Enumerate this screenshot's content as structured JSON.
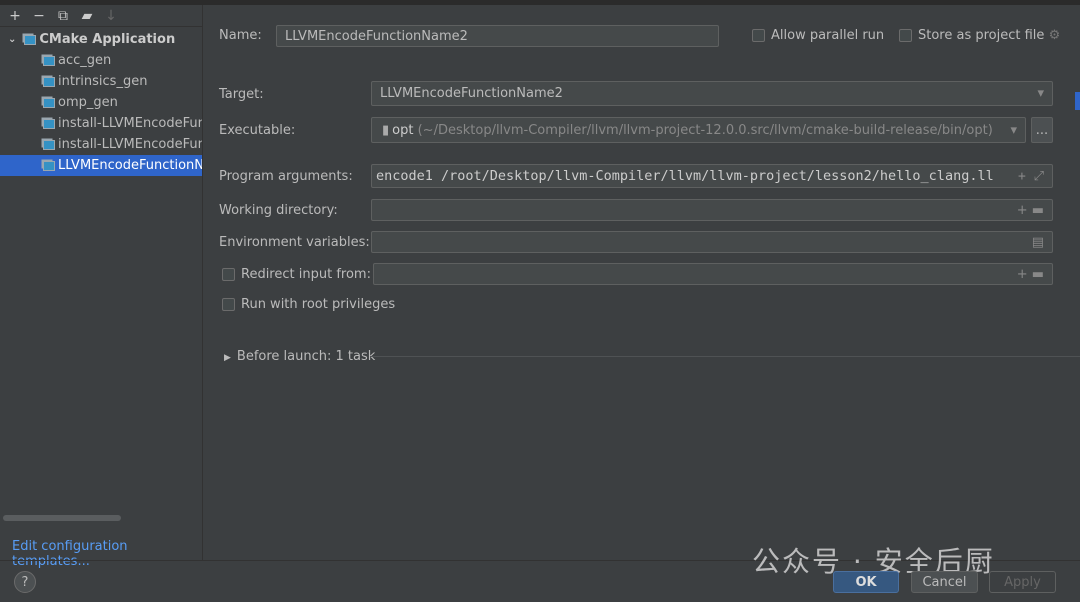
{
  "sidebar": {
    "toolbar": [
      "+",
      "−",
      "⧉",
      "▰",
      "↓"
    ],
    "group": "CMake Application",
    "items": [
      "acc_gen",
      "intrinsics_gen",
      "omp_gen",
      "install-LLVMEncodeFun",
      "install-LLVMEncodeFun",
      "LLVMEncodeFunctionNa"
    ],
    "selected_index": 5,
    "edit_templates": "Edit configuration templates..."
  },
  "form": {
    "name_label": "Name:",
    "name_value": "LLVMEncodeFunctionName2",
    "allow_parallel": "Allow parallel run",
    "store_project": "Store as project file",
    "target_label": "Target:",
    "target_value": "LLVMEncodeFunctionName2",
    "exec_label": "Executable:",
    "exec_name": "opt",
    "exec_path": "(~/Desktop/llvm-Compiler/llvm/llvm-project-12.0.0.src/llvm/cmake-build-release/bin/opt)",
    "browse": "...",
    "args_label": "Program arguments:",
    "args_value": "encode1 /root/Desktop/llvm-Compiler/llvm/llvm-project/lesson2/hello_clang.ll",
    "wd_label": "Working directory:",
    "wd_value": "",
    "env_label": "Environment variables:",
    "env_value": "",
    "redirect_label": "Redirect input from:",
    "redirect_value": "",
    "root_label": "Run with root privileges",
    "before_launch": "Before launch: 1 task"
  },
  "footer": {
    "help": "?",
    "ok": "OK",
    "cancel": "Cancel",
    "apply": "Apply"
  },
  "watermark": "公众号 · 安全后厨",
  "colors": {
    "accent": "#2f65ca",
    "ok": "#365880",
    "link": "#589df6"
  }
}
